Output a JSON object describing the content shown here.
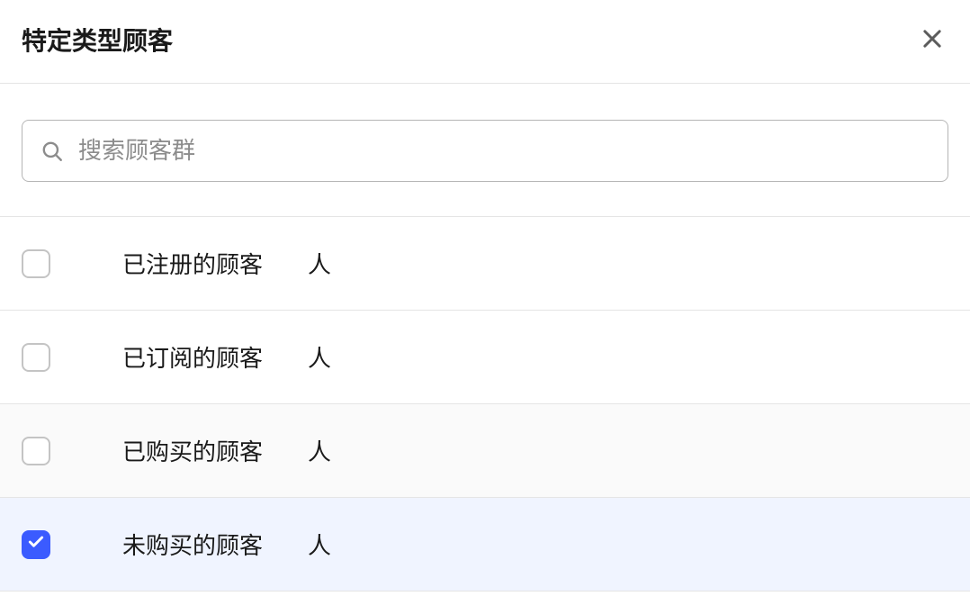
{
  "modal": {
    "title": "特定类型顾客"
  },
  "search": {
    "placeholder": "搜索顾客群"
  },
  "list": {
    "items": [
      {
        "label": "已注册的顾客",
        "count": "",
        "unit": "人",
        "checked": false,
        "alt": false
      },
      {
        "label": "已订阅的顾客",
        "count": "",
        "unit": "人",
        "checked": false,
        "alt": false
      },
      {
        "label": "已购买的顾客",
        "count": "",
        "unit": "人",
        "checked": false,
        "alt": true
      },
      {
        "label": "未购买的顾客",
        "count": "",
        "unit": "人",
        "checked": true,
        "alt": false
      }
    ]
  }
}
